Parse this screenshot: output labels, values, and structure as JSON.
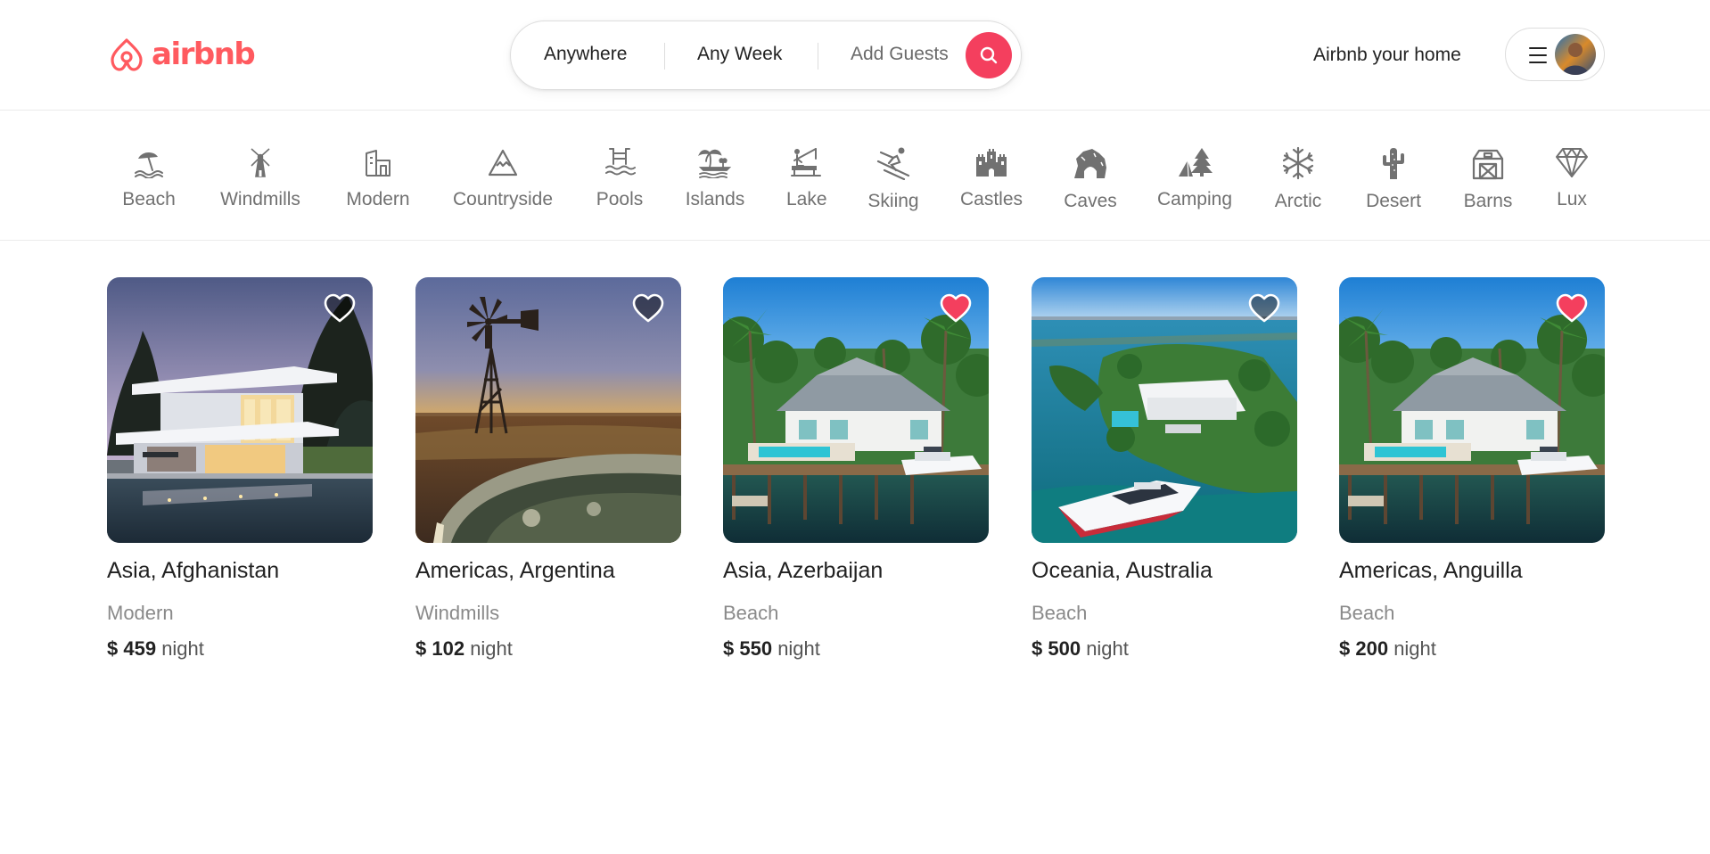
{
  "brand": {
    "name": "airbnb",
    "color": "#ff5a5f"
  },
  "search": {
    "where": "Anywhere",
    "when": "Any Week",
    "guests": "Add Guests",
    "button_icon": "search-icon",
    "button_color": "#f43f5e"
  },
  "header": {
    "host_link": "Airbnb your home",
    "menu_icon": "hamburger-menu-icon",
    "avatar": "user-avatar"
  },
  "categories": [
    {
      "label": "Beach",
      "icon": "beach-icon"
    },
    {
      "label": "Windmills",
      "icon": "windmill-icon"
    },
    {
      "label": "Modern",
      "icon": "modern-building-icon"
    },
    {
      "label": "Countryside",
      "icon": "mountain-icon"
    },
    {
      "label": "Pools",
      "icon": "pool-icon"
    },
    {
      "label": "Islands",
      "icon": "island-icon"
    },
    {
      "label": "Lake",
      "icon": "lake-icon"
    },
    {
      "label": "Skiing",
      "icon": "skiing-icon"
    },
    {
      "label": "Castles",
      "icon": "castle-icon"
    },
    {
      "label": "Caves",
      "icon": "cave-icon"
    },
    {
      "label": "Camping",
      "icon": "camping-icon"
    },
    {
      "label": "Arctic",
      "icon": "snowflake-icon"
    },
    {
      "label": "Desert",
      "icon": "cactus-icon"
    },
    {
      "label": "Barns",
      "icon": "barn-icon"
    },
    {
      "label": "Lux",
      "icon": "diamond-icon"
    }
  ],
  "listings": [
    {
      "location": "Asia, Afghanistan",
      "category": "Modern",
      "price": "$ 459",
      "unit": "night",
      "favorited": false,
      "image": "modern-villa-at-dusk"
    },
    {
      "location": "Americas, Argentina",
      "category": "Windmills",
      "price": "$ 102",
      "unit": "night",
      "favorited": false,
      "image": "windmill-at-sunset"
    },
    {
      "location": "Asia, Azerbaijan",
      "category": "Beach",
      "price": "$ 550",
      "unit": "night",
      "favorited": true,
      "image": "waterfront-house-with-pool"
    },
    {
      "location": "Oceania, Australia",
      "category": "Beach",
      "price": "$ 500",
      "unit": "night",
      "favorited": false,
      "image": "waterfront-villa-with-yacht"
    },
    {
      "location": "Americas, Anguilla",
      "category": "Beach",
      "price": "$ 200",
      "unit": "night",
      "favorited": true,
      "image": "waterfront-house-with-pool"
    }
  ],
  "colors": {
    "heart_favorited": "#f43f5e",
    "heart_default": "rgba(0,0,0,0.45)"
  }
}
